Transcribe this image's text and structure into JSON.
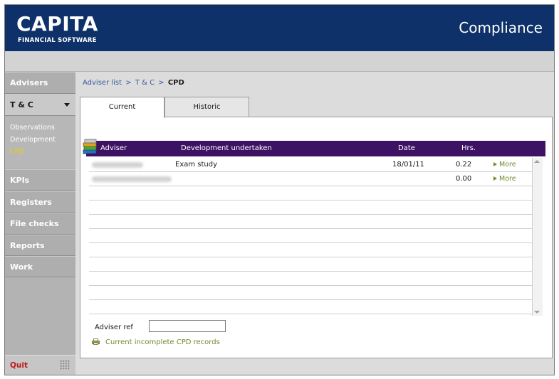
{
  "header": {
    "logo_main": "CAPITA",
    "logo_sub": "FINANCIAL SOFTWARE",
    "app_title": "Compliance"
  },
  "sidebar": {
    "items": [
      {
        "label": "Advisers"
      },
      {
        "label": "T & C"
      },
      {
        "label": "KPIs"
      },
      {
        "label": "Registers"
      },
      {
        "label": "File checks"
      },
      {
        "label": "Reports"
      },
      {
        "label": "Work"
      }
    ],
    "sub_items": [
      {
        "label": "Observations"
      },
      {
        "label": "Development"
      },
      {
        "label": "CPD"
      }
    ],
    "quit_label": "Quit"
  },
  "breadcrumb": {
    "adviser_list": "Adviser list",
    "sep1": ">",
    "tc": "T & C",
    "sep2": ">",
    "current": "CPD"
  },
  "tabs": [
    {
      "label": "Current"
    },
    {
      "label": "Historic"
    }
  ],
  "table": {
    "columns": [
      "Adviser",
      "Development undertaken",
      "Date",
      "Hrs."
    ],
    "rows": [
      {
        "development": "Exam study",
        "date": "18/01/11",
        "hrs": "0.22",
        "more": "More"
      },
      {
        "development": "",
        "date": "",
        "hrs": "0.00",
        "more": "More"
      }
    ]
  },
  "adviser_ref": {
    "label": "Adviser ref",
    "value": ""
  },
  "links": {
    "incomplete_cpd": "Current incomplete CPD records"
  },
  "colors": {
    "header_bg": "#0d3168",
    "table_header_bg": "#3d1163",
    "link_green": "#6f8a2a",
    "active_sub_item": "#f0d000",
    "quit_red": "#c01818"
  }
}
